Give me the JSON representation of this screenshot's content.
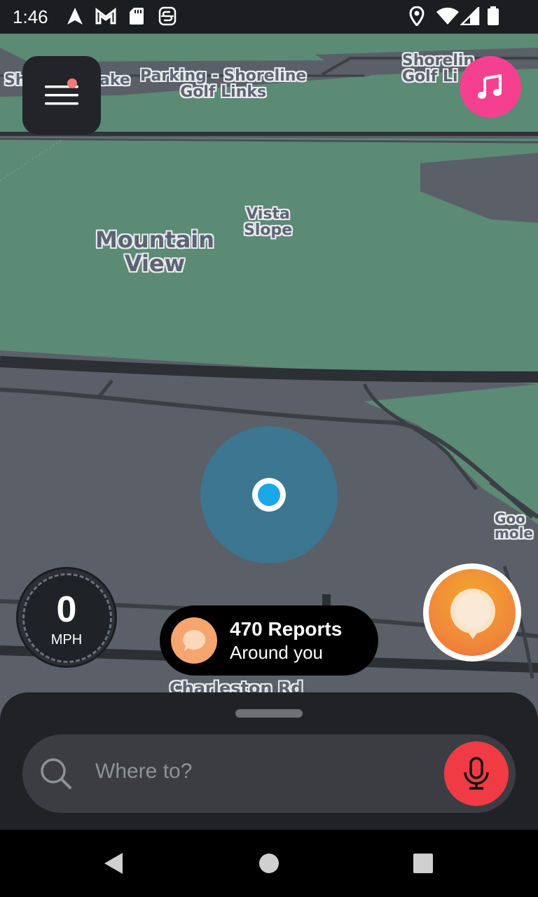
{
  "status_bar": {
    "time": "1:46",
    "left_icons": [
      "navigation-arrow-icon",
      "gmail-icon",
      "sd-card-icon",
      "app-s-icon"
    ],
    "right_icons": [
      "location-pin-icon",
      "wifi-icon",
      "signal-icon",
      "battery-icon"
    ]
  },
  "map": {
    "labels": {
      "top_left_fragment": "Sh",
      "lake_fragment": "ake",
      "parking": "Parking - Shoreline\nGolf Links",
      "shoreline_golf": "Shorelin\nGolf Li",
      "vista_slope": "Vista\nSlope",
      "mountain_view": "Mountain\nView",
      "google_fragment": "Goo\nmole",
      "charleston_rd": "Charleston Rd"
    }
  },
  "menu": {
    "has_notification": true
  },
  "speedometer": {
    "value": "0",
    "unit": "MPH"
  },
  "reports": {
    "count_text": "470 Reports",
    "subtitle": "Around you"
  },
  "search": {
    "placeholder": "Where to?"
  },
  "colors": {
    "music_button": "#f5408f",
    "mic_button": "#f03b45",
    "location_dot": "#1aa7e8",
    "report_button": "#f08a3a",
    "park_green": "#5b8a75",
    "road_gray": "#5b5f67"
  },
  "nav_bar": {
    "buttons": [
      "back-icon",
      "home-icon",
      "recents-icon"
    ]
  }
}
